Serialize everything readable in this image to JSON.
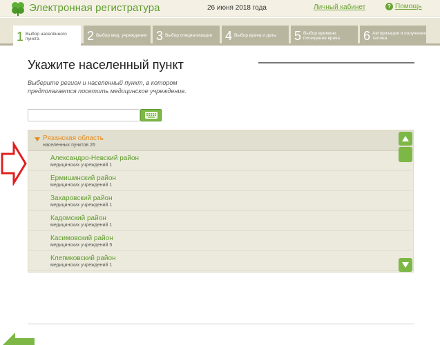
{
  "header": {
    "app_title": "Электронная регистратура",
    "date": "26 июня 2018 года",
    "cabinet_link": "Личный кабинет",
    "help_link": "Помощь",
    "help_icon_glyph": "?",
    "brand_color": "#5e9c2d"
  },
  "steps": [
    {
      "num": "1",
      "label": "Выбор населённого пункта",
      "active": true
    },
    {
      "num": "2",
      "label": "Выбор мед. учреждения",
      "active": false
    },
    {
      "num": "3",
      "label": "Выбор специализации",
      "active": false
    },
    {
      "num": "4",
      "label": "Выбор врача и даты",
      "active": false
    },
    {
      "num": "5",
      "label": "Выбор времени посещения врача",
      "active": false
    },
    {
      "num": "6",
      "label": "Авторизация и получение талона",
      "active": false
    }
  ],
  "main": {
    "title": "Укажите населенный пункт",
    "subtitle": "Выберите регион и населенный пункт, в котором предполагается посетить медицинское учреждение."
  },
  "search": {
    "value": "",
    "keyboard_icon": "keyboard-icon"
  },
  "region": {
    "name": "Рязанская область",
    "count": "населенных пунктов 26",
    "accent_color": "#e58a1f"
  },
  "districts": [
    {
      "name": "Александро-Невский район",
      "count": "медицинских учреждений 1"
    },
    {
      "name": "Ермишинский район",
      "count": "медицинских учреждений 1"
    },
    {
      "name": "Захаровский район",
      "count": "медицинских учреждений 1"
    },
    {
      "name": "Кадомский район",
      "count": "медицинских учреждений 1"
    },
    {
      "name": "Касимовский район",
      "count": "медицинских учреждений 5"
    },
    {
      "name": "Клепиковский район",
      "count": "медицинских учреждений 1"
    }
  ]
}
